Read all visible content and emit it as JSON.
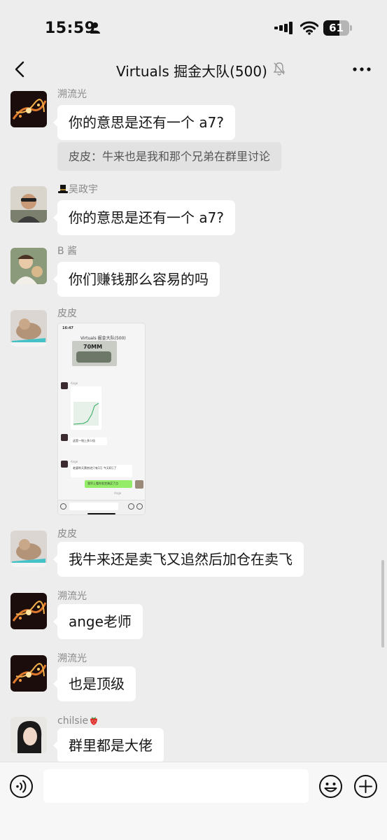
{
  "status_bar": {
    "time": "15:59",
    "battery": "61",
    "battery_level": 0.61,
    "icons": [
      "person-icon",
      "signal-icon",
      "wifi-icon",
      "battery-icon"
    ]
  },
  "header": {
    "title": "Virtuals 掘金大队(500)",
    "icons": [
      "back-icon",
      "mute-bell-icon",
      "more-icon"
    ]
  },
  "messages": [
    {
      "sender": "溯流光",
      "text": "你的意思是还有一个 a7?",
      "quote": "皮皮：牛来也是我和那个兄弟在群里讨论"
    },
    {
      "sender": "吴政宇",
      "sender_icon": "top-hat-emoji",
      "text": "你的意思是还有一个 a7?"
    },
    {
      "sender": "B 酱",
      "text": "你们赚钱那么容易的吗"
    },
    {
      "sender": "皮皮",
      "type": "image",
      "image": {
        "time": "16:47",
        "title": "Virtuals 掘金大队(500)",
        "banner_text": "70MM",
        "sender1": "Ange",
        "msg1": "这是一钱上多少倍",
        "sender2": "Ange",
        "msg2": "老婆昨天票房进只有1万 今天8万了",
        "my_msg": "我早上看你发宫骑买了点",
        "sender3": "Ange"
      }
    },
    {
      "sender": "皮皮",
      "text": "我牛来还是卖飞又追然后加仓在卖飞"
    },
    {
      "sender": "溯流光",
      "text": "ange老师"
    },
    {
      "sender": "溯流光",
      "text": "也是顶级"
    },
    {
      "sender": "chilsie",
      "sender_icon": "strawberry-emoji",
      "text": "群里都是大佬"
    }
  ],
  "input_bar": {
    "placeholder": "",
    "icons": [
      "voice-icon",
      "emoji-icon",
      "plus-icon"
    ]
  }
}
